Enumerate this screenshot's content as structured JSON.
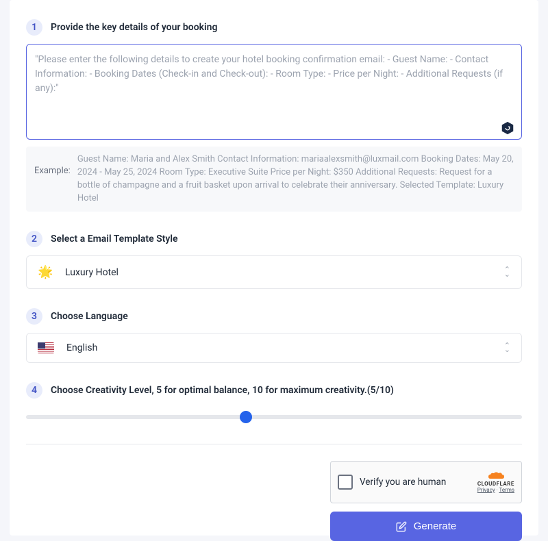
{
  "step1": {
    "number": "1",
    "title": "Provide the key details of your booking",
    "placeholder": "\"Please enter the following details to create your hotel booking confirmation email: - Guest Name: - Contact Information: - Booking Dates (Check-in and Check-out): - Room Type: - Price per Night: - Additional Requests (if any):\"",
    "example_label": "Example:",
    "example_text": "Guest Name: Maria and Alex Smith Contact Information: mariaalexsmith@luxmail.com Booking Dates: May 20, 2024 - May 25, 2024 Room Type: Executive Suite Price per Night: $350 Additional Requests: Request for a bottle of champagne and a fruit basket upon arrival to celebrate their anniversary. Selected Template: Luxury Hotel"
  },
  "step2": {
    "number": "2",
    "title": "Select a Email Template Style",
    "icon": "🌟",
    "value": "Luxury Hotel"
  },
  "step3": {
    "number": "3",
    "title": "Choose Language",
    "value": "English"
  },
  "step4": {
    "number": "4",
    "title": "Choose Creativity Level, 5 for optimal balance, 10 for maximum creativity.(5/10)",
    "value": 5,
    "max": 10,
    "thumb_left_pct": "44.4%"
  },
  "captcha": {
    "text": "Verify you are human",
    "logo": "CLOUDFLARE",
    "privacy": "Privacy",
    "terms": "Terms"
  },
  "generate_label": "Generate"
}
